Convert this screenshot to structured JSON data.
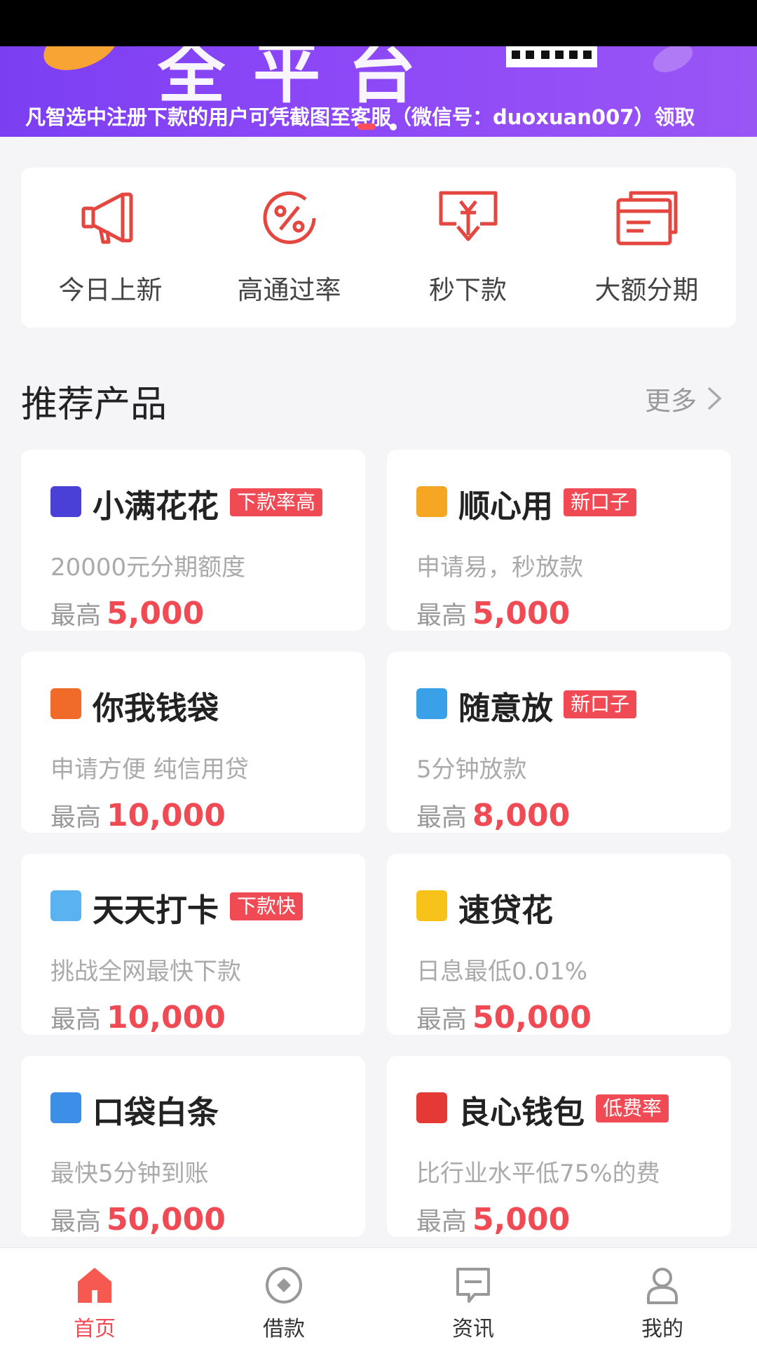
{
  "banner": {
    "headline_partial": "全平台",
    "notice": "凡智选中注册下款的用户可凭截图至客服（微信号：duoxuan007）领取"
  },
  "quick_entries": [
    {
      "label": "今日上新",
      "icon": "megaphone-icon"
    },
    {
      "label": "高通过率",
      "icon": "percent-icon"
    },
    {
      "label": "秒下款",
      "icon": "yuan-download-icon"
    },
    {
      "label": "大额分期",
      "icon": "cards-icon"
    }
  ],
  "section": {
    "title": "推荐产品",
    "more": "更多"
  },
  "products": [
    {
      "name": "小满花花",
      "tag": "下款率高",
      "desc": "20000元分期额度",
      "max_label": "最高",
      "amount": "5,000",
      "logo_color": "#4a3fd6"
    },
    {
      "name": "顺心用",
      "tag": "新口子",
      "desc": "申请易，秒放款",
      "max_label": "最高",
      "amount": "5,000",
      "logo_color": "#f5a623"
    },
    {
      "name": "你我钱袋",
      "tag": "",
      "desc": "申请方便 纯信用贷",
      "max_label": "最高",
      "amount": "10,000",
      "logo_color": "#f06a2a"
    },
    {
      "name": "随意放",
      "tag": "新口子",
      "desc": "5分钟放款",
      "max_label": "最高",
      "amount": "8,000",
      "logo_color": "#3aa0e8"
    },
    {
      "name": "天天打卡",
      "tag": "下款快",
      "desc": "挑战全网最快下款",
      "max_label": "最高",
      "amount": "10,000",
      "logo_color": "#5bb2f0"
    },
    {
      "name": "速贷花",
      "tag": "",
      "desc": "日息最低0.01%",
      "max_label": "最高",
      "amount": "50,000",
      "logo_color": "#f7c21a"
    },
    {
      "name": "口袋白条",
      "tag": "",
      "desc": "最快5分钟到账",
      "max_label": "最高",
      "amount": "50,000",
      "logo_color": "#3d8ee6"
    },
    {
      "name": "良心钱包",
      "tag": "低费率",
      "desc": "比行业水平低75%的费",
      "max_label": "最高",
      "amount": "5,000",
      "logo_color": "#e53935"
    }
  ],
  "tabs": [
    {
      "label": "首页",
      "icon": "home-icon",
      "active": true
    },
    {
      "label": "借款",
      "icon": "loan-icon",
      "active": false
    },
    {
      "label": "资讯",
      "icon": "news-icon",
      "active": false
    },
    {
      "label": "我的",
      "icon": "profile-icon",
      "active": false
    }
  ],
  "colors": {
    "accent": "#f04b55",
    "banner": "#8d48f7",
    "icon_red": "#e4473f"
  }
}
